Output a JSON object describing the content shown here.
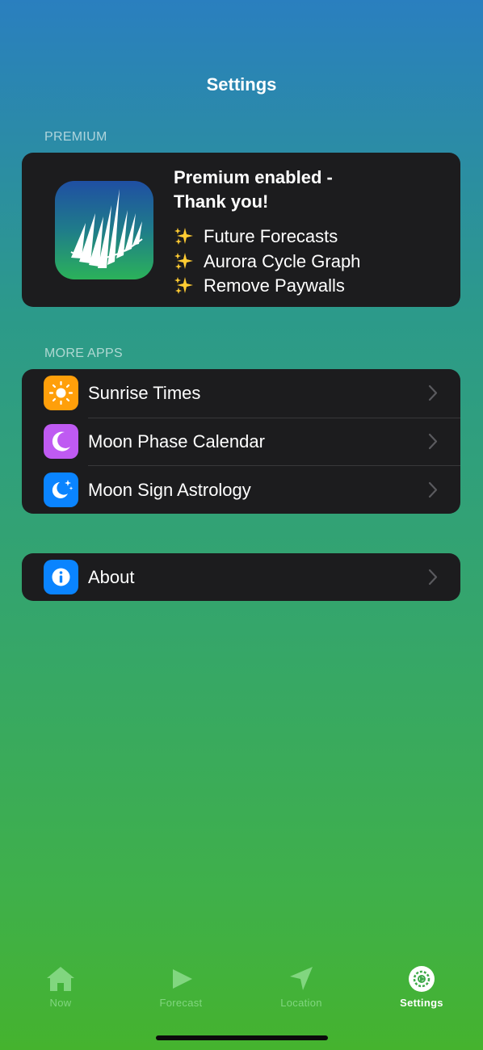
{
  "header": {
    "title": "Settings"
  },
  "premium": {
    "section_label": "PREMIUM",
    "title_line1": "Premium enabled -",
    "title_line2": "Thank you!",
    "features": [
      "Future Forecasts",
      "Aurora Cycle Graph",
      "Remove Paywalls"
    ],
    "app_icon": "aurora-icon"
  },
  "more_apps": {
    "section_label": "MORE APPS",
    "items": [
      {
        "label": "Sunrise Times",
        "icon": "sun-icon",
        "color": "#ff9f0a"
      },
      {
        "label": "Moon Phase Calendar",
        "icon": "crescent-moon-icon",
        "color": "#bf5af2"
      },
      {
        "label": "Moon Sign Astrology",
        "icon": "moon-stars-icon",
        "color": "#0a84ff"
      }
    ]
  },
  "about": {
    "label": "About",
    "icon": "info-icon",
    "color": "#0a84ff"
  },
  "tabbar": {
    "tabs": [
      {
        "label": "Now",
        "icon": "house-icon",
        "active": false
      },
      {
        "label": "Forecast",
        "icon": "play-icon",
        "active": false
      },
      {
        "label": "Location",
        "icon": "location-arrow-icon",
        "active": false
      },
      {
        "label": "Settings",
        "icon": "gear-icon",
        "active": true
      }
    ]
  }
}
